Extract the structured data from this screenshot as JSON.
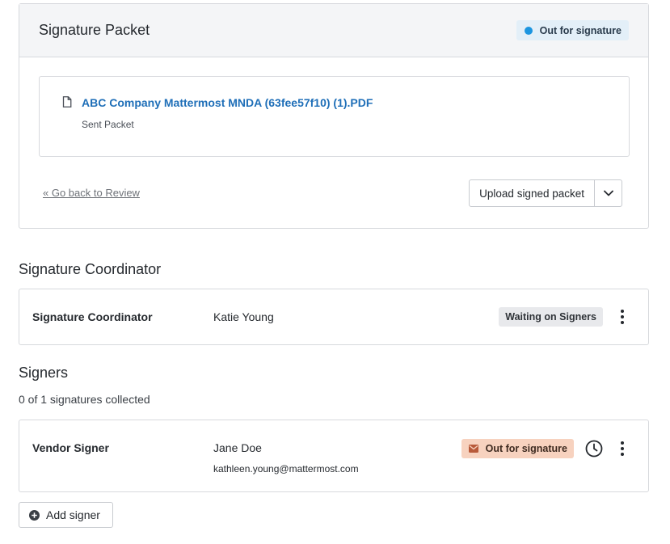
{
  "packet": {
    "title": "Signature Packet",
    "status": "Out for signature",
    "status_color": "#1b95e0",
    "document": {
      "icon": "document-icon",
      "name": "ABC Company Mattermost MNDA (63fee57f10) (1).PDF",
      "subtitle": "Sent Packet"
    },
    "back_link": "« Go back to Review",
    "upload_button": "Upload signed packet",
    "upload_dropdown_icon": "chevron-down-icon"
  },
  "coordinator_section": {
    "heading": "Signature Coordinator",
    "row": {
      "role": "Signature Coordinator",
      "name": "Katie Young",
      "badge": "Waiting on Signers",
      "menu_icon": "kebab-icon"
    }
  },
  "signers_section": {
    "heading": "Signers",
    "count_text": "0 of 1 signatures collected",
    "signers": [
      {
        "role": "Vendor Signer",
        "name": "Jane Doe",
        "email": "kathleen.young@mattermost.com",
        "status": "Out for signature",
        "status_icon": "mail-icon",
        "status_color": "#f7d2bf",
        "history_icon": "clock-icon",
        "menu_icon": "kebab-icon"
      }
    ],
    "add_button": "Add signer",
    "add_icon": "plus-circle-icon"
  }
}
